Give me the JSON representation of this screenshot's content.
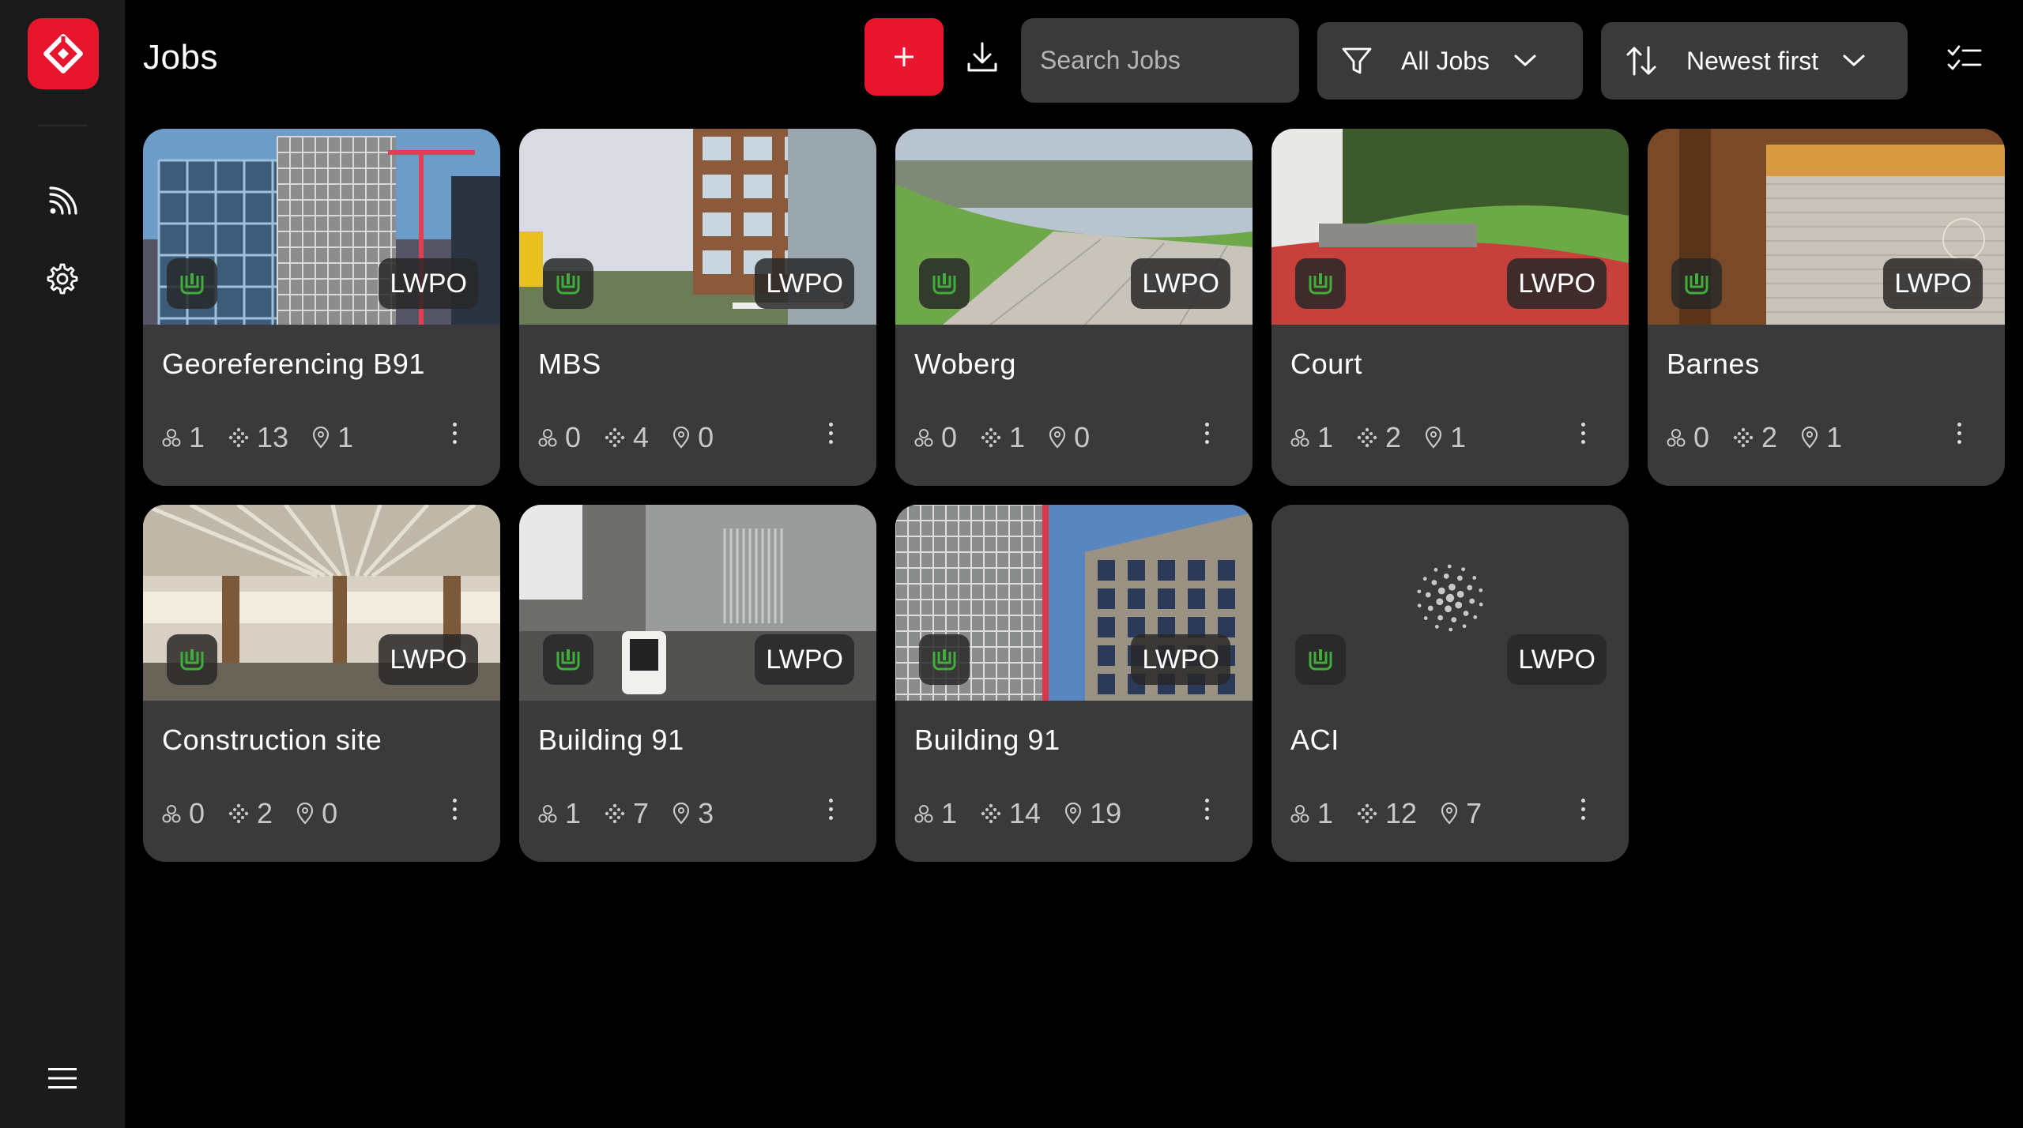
{
  "app": {
    "title": "Jobs",
    "accent": "#e8152f"
  },
  "sidebar": {
    "items": [
      {
        "icon": "feed-icon"
      },
      {
        "icon": "gear-icon"
      }
    ],
    "bottom_icon": "menu-icon"
  },
  "toolbar": {
    "search_placeholder": "Search Jobs",
    "filter_label": "All Jobs",
    "sort_label": "Newest first"
  },
  "jobs": [
    {
      "name": "Georeferencing B91",
      "badge": "LWPO",
      "users": "1",
      "scans": "13",
      "points": "1",
      "thumb": "construction-glass"
    },
    {
      "name": "MBS",
      "badge": "LWPO",
      "users": "0",
      "scans": "4",
      "points": "0",
      "thumb": "office-street"
    },
    {
      "name": "Woberg",
      "badge": "LWPO",
      "users": "0",
      "scans": "1",
      "points": "0",
      "thumb": "lawn-view"
    },
    {
      "name": "Court",
      "badge": "LWPO",
      "users": "1",
      "scans": "2",
      "points": "1",
      "thumb": "red-court"
    },
    {
      "name": "Barnes",
      "badge": "LWPO",
      "users": "0",
      "scans": "2",
      "points": "1",
      "thumb": "wood-interior"
    },
    {
      "name": "Construction site",
      "badge": "LWPO",
      "users": "0",
      "scans": "2",
      "points": "0",
      "thumb": "interior-beams"
    },
    {
      "name": "Building 91",
      "badge": "LWPO",
      "users": "1",
      "scans": "7",
      "points": "3",
      "thumb": "scanner-garage"
    },
    {
      "name": "Building 91",
      "badge": "LWPO",
      "users": "1",
      "scans": "14",
      "points": "19",
      "thumb": "building-facade"
    },
    {
      "name": "ACI",
      "badge": "LWPO",
      "users": "1",
      "scans": "12",
      "points": "7",
      "thumb": "point-cloud-loader"
    }
  ]
}
